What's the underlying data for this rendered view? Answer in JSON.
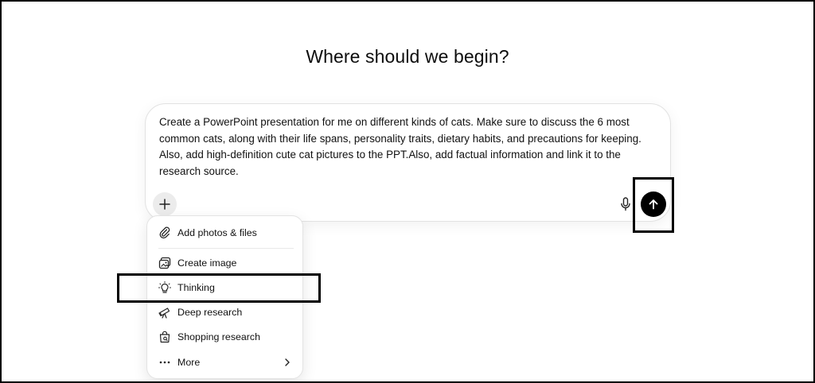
{
  "heading": "Where should we begin?",
  "composer": {
    "prompt_text": "Create a PowerPoint presentation for me on different kinds of cats. Make sure to discuss the 6 most common cats, along with their life spans, personality traits, dietary habits, and precautions for keeping. Also, add high-definition cute cat pictures to the PPT.Also, add factual information and link it to the research source.",
    "plus_icon": "plus-icon",
    "mic_icon": "microphone-icon",
    "send_icon": "arrow-up-icon"
  },
  "menu": {
    "items": [
      {
        "label": "Add photos & files",
        "icon": "paperclip-icon"
      },
      {
        "label": "Create image",
        "icon": "image-icon"
      },
      {
        "label": "Thinking",
        "icon": "lightbulb-icon"
      },
      {
        "label": "Deep research",
        "icon": "telescope-icon"
      },
      {
        "label": "Shopping research",
        "icon": "shopping-bag-icon"
      },
      {
        "label": "More",
        "icon": "ellipsis-icon"
      }
    ]
  },
  "colors": {
    "send_button": "#000000",
    "plus_button_bg": "#ececec",
    "border": "#e2e2e2"
  }
}
